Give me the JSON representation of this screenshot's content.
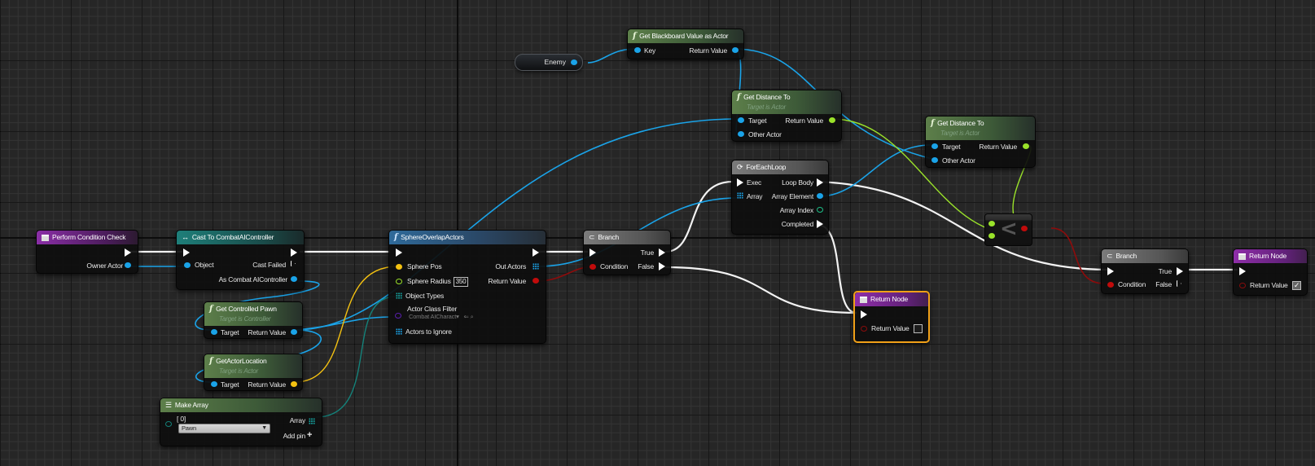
{
  "editor": "Blueprint graph",
  "nodes": {
    "perform_condition_check": {
      "title": "Perform Condition Check",
      "pins": {
        "owner_actor": "Owner Actor"
      }
    },
    "cast_to": {
      "title": "Cast To CombatAIController",
      "pins": {
        "object": "Object",
        "cast_failed": "Cast Failed",
        "as_controller": "As Combat AIController"
      }
    },
    "get_controlled_pawn": {
      "title": "Get Controlled Pawn",
      "subtitle": "Target is Controller",
      "pins": {
        "target": "Target",
        "return_value": "Return Value"
      }
    },
    "get_actor_location": {
      "title": "GetActorLocation",
      "subtitle": "Target is Actor",
      "pins": {
        "target": "Target",
        "return_value": "Return Value"
      }
    },
    "make_array": {
      "title": "Make Array",
      "index_label": "[ 0]",
      "selected_class": "Pawn",
      "pins": {
        "array": "Array",
        "add_pin": "Add pin"
      }
    },
    "sphere_overlap": {
      "title": "SphereOverlapActors",
      "pins": {
        "sphere_pos": "Sphere Pos",
        "sphere_radius": "Sphere Radius",
        "sphere_radius_value": "350",
        "object_types": "Object Types",
        "actor_class_filter": "Actor Class Filter",
        "actor_class_value": "Combat AICharact",
        "actors_to_ignore": "Actors to Ignore",
        "out_actors": "Out Actors",
        "return_value": "Return Value"
      }
    },
    "enemy_var": {
      "label": "Enemy"
    },
    "get_blackboard": {
      "title": "Get Blackboard Value as Actor",
      "pins": {
        "key": "Key",
        "return_value": "Return Value"
      }
    },
    "get_distance_1": {
      "title": "Get Distance To",
      "subtitle": "Target is Actor",
      "pins": {
        "target": "Target",
        "other_actor": "Other Actor",
        "return_value": "Return Value"
      }
    },
    "get_distance_2": {
      "title": "Get Distance To",
      "subtitle": "Target is Actor",
      "pins": {
        "target": "Target",
        "other_actor": "Other Actor",
        "return_value": "Return Value"
      }
    },
    "branch_1": {
      "title": "Branch",
      "pins": {
        "condition": "Condition",
        "true": "True",
        "false": "False"
      }
    },
    "foreach": {
      "title": "ForEachLoop",
      "pins": {
        "exec": "Exec",
        "array": "Array",
        "loop_body": "Loop Body",
        "array_element": "Array Element",
        "array_index": "Array Index",
        "completed": "Completed"
      }
    },
    "return_false": {
      "title": "Return Node",
      "pins": {
        "return_value": "Return Value"
      },
      "checked": false
    },
    "compare": {
      "operator": "<"
    },
    "branch_2": {
      "title": "Branch",
      "pins": {
        "condition": "Condition",
        "true": "True",
        "false": "False"
      }
    },
    "return_true": {
      "title": "Return Node",
      "pins": {
        "return_value": "Return Value"
      },
      "checked": true
    }
  },
  "colors": {
    "exec": "#f2f2f2",
    "object": "#1aa3e8",
    "vector": "#f5c211",
    "float": "#9ae22a",
    "bool": "#c10b0b",
    "array_objtype": "#14827a",
    "selected_outline": "#f0a018"
  }
}
